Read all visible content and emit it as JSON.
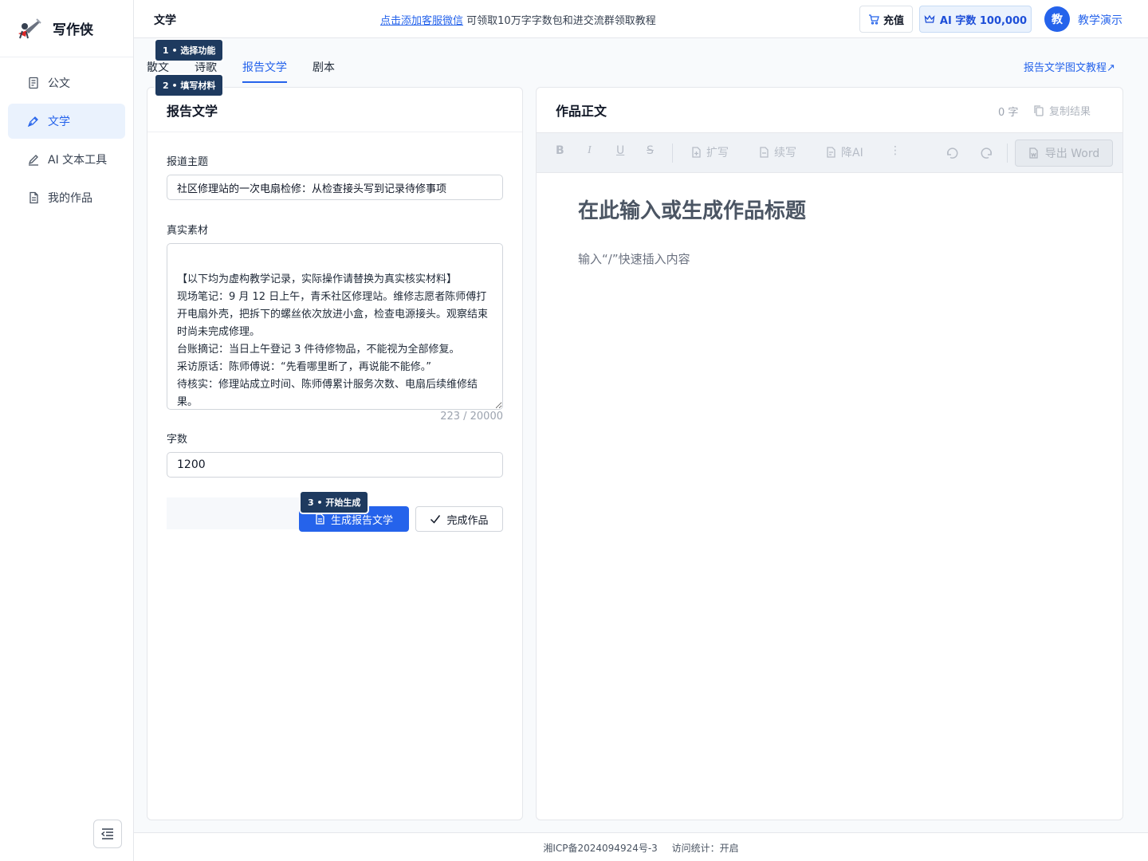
{
  "brand": {
    "name": "写作侠"
  },
  "sidebar": {
    "items": [
      {
        "label": "公文",
        "icon": "document-icon"
      },
      {
        "label": "文学",
        "icon": "pen-nib-icon"
      },
      {
        "label": "AI 文本工具",
        "icon": "pencil-icon"
      },
      {
        "label": "我的作品",
        "icon": "file-icon"
      }
    ],
    "active_index": 1
  },
  "topbar": {
    "title": "文学",
    "notice_link": "点击添加客服微信",
    "notice_text": "可领取10万字字数包和进交流群领取教程",
    "recharge_label": "充值",
    "ai_words_label": "AI 字数 100,000",
    "avatar_text": "教",
    "username": "教学演示"
  },
  "tabs": [
    {
      "label": "散文"
    },
    {
      "label": "诗歌"
    },
    {
      "label": "报告文学"
    },
    {
      "label": "剧本"
    }
  ],
  "active_tab": 2,
  "tutorial_link": "报告文学图文教程↗",
  "steps": {
    "step1": "1 • 选择功能",
    "step2": "2 • 填写材料",
    "step3": "3 • 开始生成"
  },
  "form": {
    "panel_title": "报告文学",
    "topic_label": "报道主题",
    "topic_value": "社区修理站的一次电扇检修：从检查接头写到记录待修事项",
    "material_label": "真实素材",
    "material_value": "【以下均为虚构教学记录，实际操作请替换为真实核实材料】\n现场笔记：9 月 12 日上午，青禾社区修理站。维修志愿者陈师傅打开电扇外壳，把拆下的螺丝依次放进小盒，检查电源接头。观察结束时尚未完成修理。\n台账摘记：当日上午登记 3 件待修物品，不能视为全部修复。\n采访原话：陈师傅说：“先看哪里断了，再说能不能修。”\n待核实：修理站成立时间、陈师傅累计服务次数、电扇后续维修结果。\n写作要求：围绕本次检修展开，不补人物内心，不编造现场对话或长期成绩。",
    "material_counter": "223 / 20000",
    "wordcount_label": "字数",
    "wordcount_value": "1200",
    "generate_label": "生成报告文学",
    "finish_label": "完成作品"
  },
  "editor": {
    "panel_title": "作品正文",
    "word_count": "0 字",
    "copy_label": "复制结果",
    "toolbar": {
      "bold": "B",
      "italic": "I",
      "underline": "U",
      "strike": "S",
      "expand": "扩写",
      "continue": "续写",
      "reduce_ai": "降AI",
      "more": "⋮",
      "export": "导出 Word"
    },
    "title_placeholder": "在此输入或生成作品标题",
    "body_placeholder": "输入“/”快速插入内容"
  },
  "footer": {
    "icp": "湘ICP备2024094924号-3",
    "stats": "访问统计：开启"
  },
  "colors": {
    "accent": "#2563eb",
    "step_badge": "#1e3a5f"
  }
}
